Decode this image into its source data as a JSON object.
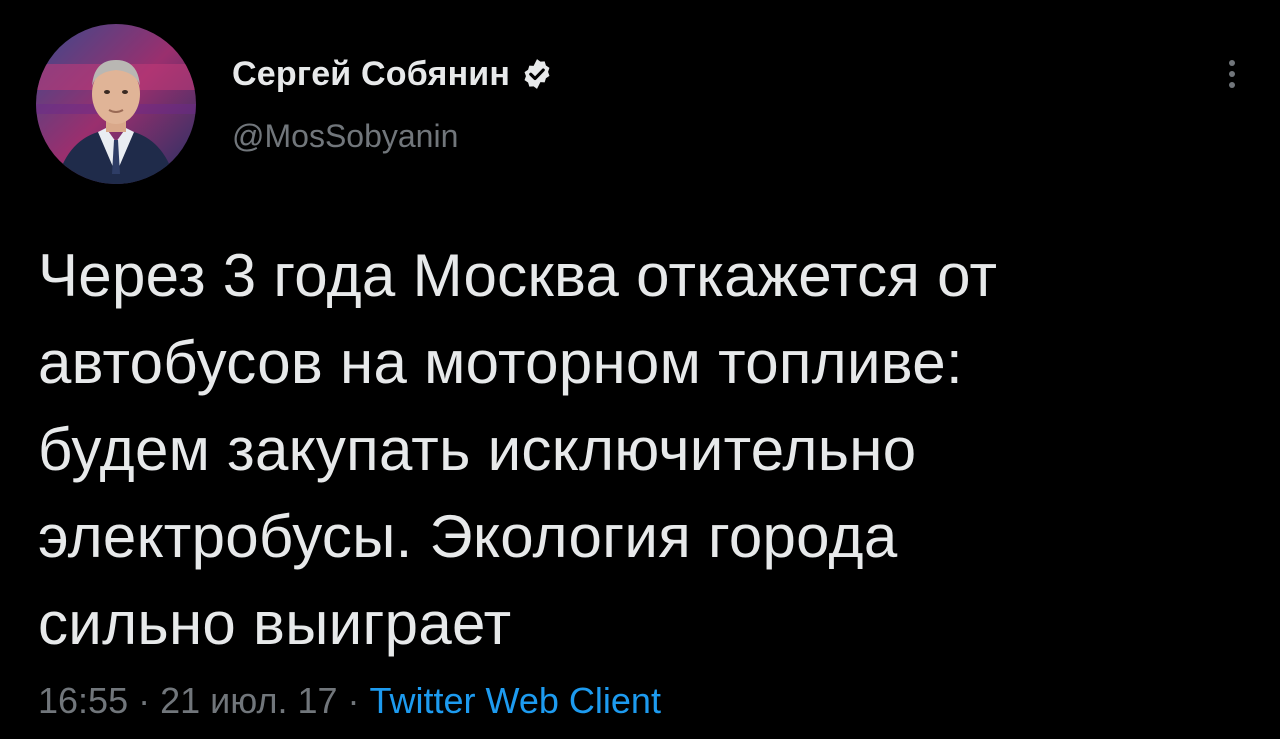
{
  "author": {
    "display_name": "Сергей Собянин",
    "handle": "@MosSobyanin",
    "verified": true
  },
  "tweet": {
    "lines": [
      "Через 3 года Москва откажется от",
      "автобусов на моторном топливе:",
      "будем закупать исключительно",
      "электробусы. Экология города",
      "сильно выиграет"
    ]
  },
  "meta": {
    "time": "16:55",
    "sep1": " · ",
    "date": "21 июл. 17",
    "sep2": " · ",
    "source": "Twitter Web Client"
  },
  "icons": {
    "verified": "verified-badge-icon",
    "more": "more-vertical-icon"
  },
  "colors": {
    "background": "#000000",
    "text": "#e7e9ea",
    "secondary": "#71767b",
    "accent": "#1d9bf0"
  }
}
